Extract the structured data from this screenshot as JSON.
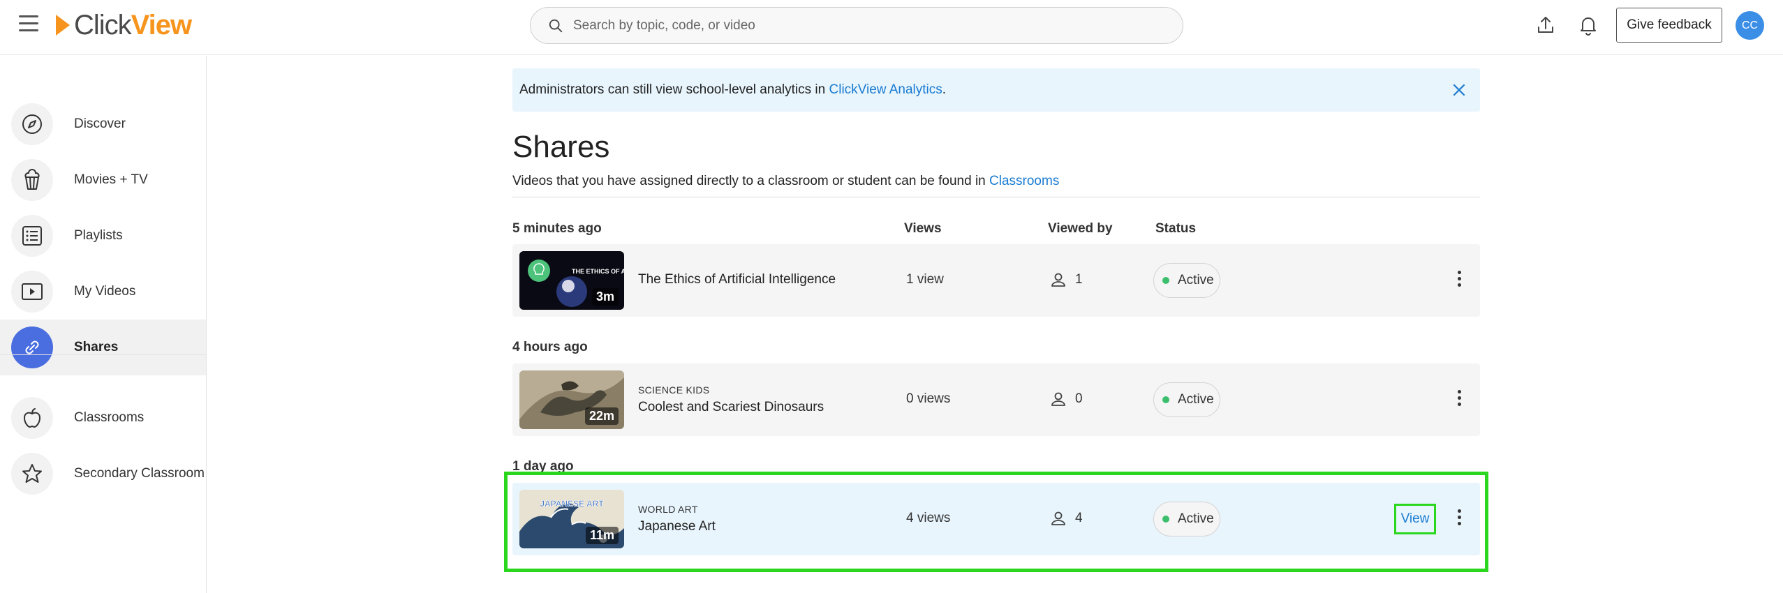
{
  "header": {
    "logo_prefix": "Click",
    "logo_suffix": "View",
    "search_placeholder": "Search by topic, code, or video",
    "feedback_label": "Give feedback",
    "avatar_initials": "CC"
  },
  "sidebar": {
    "items": [
      {
        "label": "Discover",
        "icon": "compass-icon"
      },
      {
        "label": "Movies + TV",
        "icon": "popcorn-icon"
      },
      {
        "label": "Playlists",
        "icon": "playlist-icon"
      },
      {
        "label": "My Videos",
        "icon": "video-icon"
      },
      {
        "label": "Shares",
        "icon": "link-icon",
        "active": true
      },
      {
        "label": "Classrooms",
        "icon": "apple-icon"
      },
      {
        "label": "Secondary Classroom",
        "icon": "star-icon"
      }
    ]
  },
  "banner": {
    "text": "Administrators can still view school-level analytics in ",
    "link": "ClickView Analytics",
    "suffix": "."
  },
  "page": {
    "title": "Shares",
    "subtitle": "Videos that you have assigned directly to a classroom or student can be found in ",
    "subtitle_link": "Classrooms"
  },
  "columns": {
    "views": "Views",
    "viewed_by": "Viewed by",
    "status": "Status"
  },
  "groups": [
    {
      "label": "5 minutes ago",
      "items": [
        {
          "category": "",
          "title": "The Ethics of Artificial Intelligence",
          "duration": "3m",
          "views": "1 view",
          "viewed_by": "1",
          "status": "Active",
          "thumb_text": "THE ETHICS OF AI"
        }
      ]
    },
    {
      "label": "4 hours ago",
      "items": [
        {
          "category": "SCIENCE KIDS",
          "title": "Coolest and Scariest Dinosaurs",
          "duration": "22m",
          "views": "0 views",
          "viewed_by": "0",
          "status": "Active"
        }
      ]
    },
    {
      "label": "1 day ago",
      "items": [
        {
          "category": "WORLD ART",
          "title": "Japanese Art",
          "duration": "11m",
          "views": "4 views",
          "viewed_by": "4",
          "status": "Active",
          "action": "View",
          "thumb_text": "JAPANESE ART"
        }
      ]
    }
  ],
  "colors": {
    "accent": "#f7941d",
    "link": "#1a7bd0",
    "active_nav": "#4a6de0",
    "banner_bg": "#e8f5fd",
    "status_dot": "#3bbf6d",
    "highlight": "#2ad61e"
  }
}
